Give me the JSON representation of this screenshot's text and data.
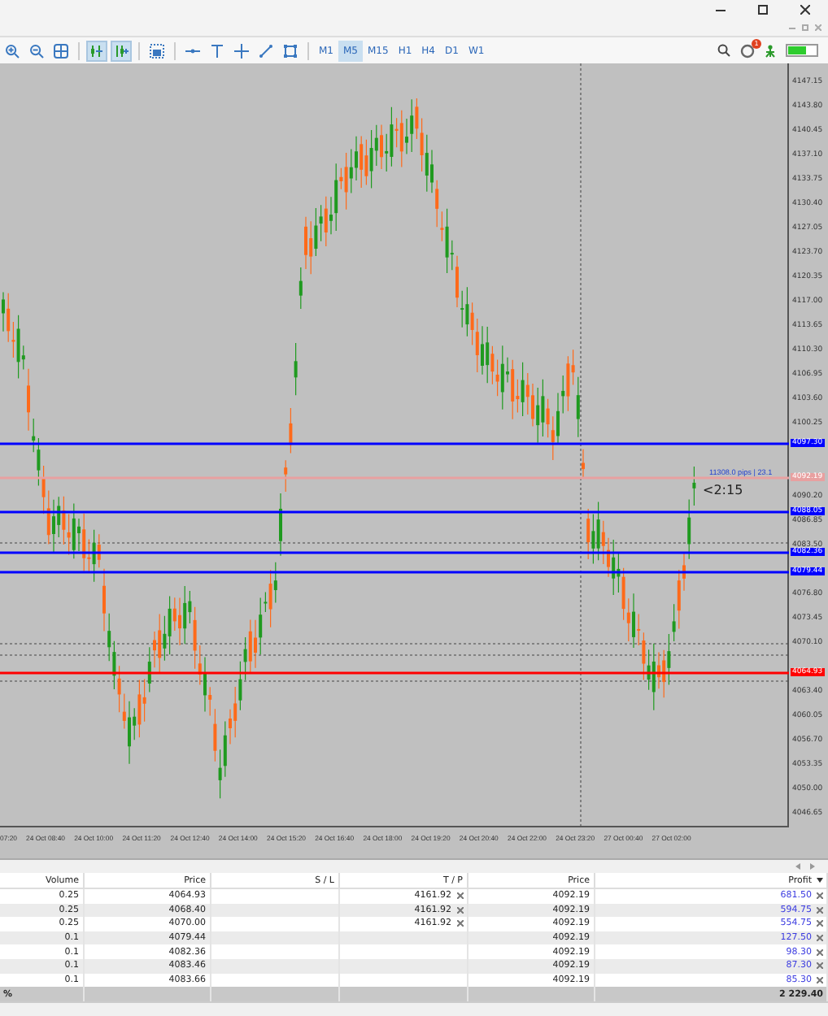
{
  "toolbar": {
    "tools": [
      {
        "kind": "zoom-in",
        "selected": false
      },
      {
        "kind": "zoom-out",
        "selected": false
      },
      {
        "kind": "grid",
        "selected": false
      },
      {
        "kind": "chart-shift",
        "selected": true
      },
      {
        "kind": "autoscroll",
        "selected": true
      },
      {
        "kind": "screenshot",
        "selected": false
      },
      {
        "kind": "horizontal-line",
        "selected": false
      },
      {
        "kind": "text",
        "selected": false
      },
      {
        "kind": "crosshair",
        "selected": false
      },
      {
        "kind": "trend-line",
        "selected": false
      },
      {
        "kind": "rectangle",
        "selected": false
      }
    ],
    "timeframes": [
      {
        "label": "M1",
        "selected": false
      },
      {
        "label": "M5",
        "selected": true
      },
      {
        "label": "M15",
        "selected": false
      },
      {
        "label": "H1",
        "selected": false
      },
      {
        "label": "H4",
        "selected": false
      },
      {
        "label": "D1",
        "selected": false
      },
      {
        "label": "W1",
        "selected": false
      }
    ],
    "notification_badge": "1"
  },
  "chart": {
    "price_ticks": [
      "4147.15",
      "4143.80",
      "4140.45",
      "4137.10",
      "4133.75",
      "4130.40",
      "4127.05",
      "4123.70",
      "4120.35",
      "4117.00",
      "4113.65",
      "4110.30",
      "4106.95",
      "4103.60",
      "4100.25",
      "4090.20",
      "4086.85",
      "4083.50",
      "4076.80",
      "4073.45",
      "4070.10",
      "4063.40",
      "4060.05",
      "4056.70",
      "4053.35",
      "4050.00",
      "4046.65"
    ],
    "level_lines": [
      {
        "label": "4097.30",
        "color": "#0000ff"
      },
      {
        "label": "4092.19",
        "color": "#e8a0a0"
      },
      {
        "label": "4088.05",
        "color": "#0000ff"
      },
      {
        "label": "4082.36",
        "color": "#0000ff"
      },
      {
        "label": "4079.44",
        "color": "#0000ff"
      },
      {
        "label": "4064.93",
        "color": "#ff0000"
      }
    ],
    "overlay_text": "11308.0 pips | 23.1",
    "countdown": "<2:15",
    "time_labels": [
      "07:20",
      "24 Oct 08:40",
      "24 Oct 10:00",
      "24 Oct 11:20",
      "24 Oct 12:40",
      "24 Oct 14:00",
      "24 Oct 15:20",
      "24 Oct 16:40",
      "24 Oct 18:00",
      "24 Oct 19:20",
      "24 Oct 20:40",
      "24 Oct 22:00",
      "24 Oct 23:20",
      "27 Oct 00:40",
      "27 Oct 02:00"
    ]
  },
  "table": {
    "columns": [
      "Volume",
      "Price",
      "S / L",
      "T / P",
      "Price",
      "Profit"
    ],
    "rows": [
      {
        "volume": "0.25",
        "price": "4064.93",
        "sl": "",
        "tp": "4161.92",
        "current": "4092.19",
        "profit": "681.50"
      },
      {
        "volume": "0.25",
        "price": "4068.40",
        "sl": "",
        "tp": "4161.92",
        "current": "4092.19",
        "profit": "594.75"
      },
      {
        "volume": "0.25",
        "price": "4070.00",
        "sl": "",
        "tp": "4161.92",
        "current": "4092.19",
        "profit": "554.75"
      },
      {
        "volume": "0.1",
        "price": "4079.44",
        "sl": "",
        "tp": "",
        "current": "4092.19",
        "profit": "127.50"
      },
      {
        "volume": "0.1",
        "price": "4082.36",
        "sl": "",
        "tp": "",
        "current": "4092.19",
        "profit": "98.30"
      },
      {
        "volume": "0.1",
        "price": "4083.46",
        "sl": "",
        "tp": "",
        "current": "4092.19",
        "profit": "87.30"
      },
      {
        "volume": "0.1",
        "price": "4083.66",
        "sl": "",
        "tp": "",
        "current": "4092.19",
        "profit": "85.30"
      }
    ],
    "footer": {
      "label": "%",
      "total": "2 229.40"
    }
  }
}
